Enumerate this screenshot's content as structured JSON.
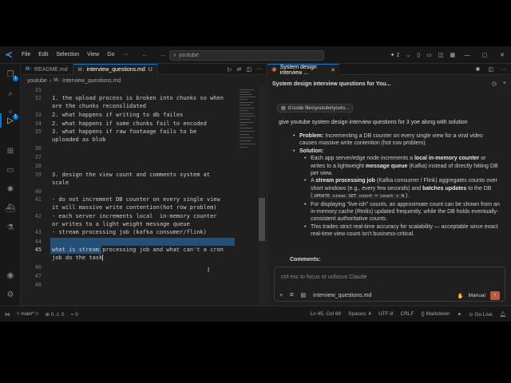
{
  "titlebar": {
    "menu": [
      "File",
      "Edit",
      "Selection",
      "View",
      "Go"
    ],
    "search": "youtube",
    "copilot_count": "2"
  },
  "activity": {
    "explorer_badge": "1",
    "scm_badge": "1"
  },
  "editor": {
    "tabs": [
      {
        "label": "README.md",
        "modified": ""
      },
      {
        "label": "interview_questions.md",
        "modified": "U"
      }
    ],
    "breadcrumb": [
      "youtube",
      "interview_questions.md"
    ],
    "lines": [
      {
        "n": "31",
        "text": ""
      },
      {
        "n": "32",
        "text": "1. the upload process is broken into chunks so when"
      },
      {
        "n": "",
        "text": "are the chunks reconslidated"
      },
      {
        "n": "33",
        "text": "2. what happens if writing to db failes"
      },
      {
        "n": "34",
        "text": "2. what happens if some chunks fail to encoded"
      },
      {
        "n": "35",
        "text": "3. what happens if raw footaage fails to be"
      },
      {
        "n": "",
        "text": "uploaded as blob"
      },
      {
        "n": "36",
        "text": ""
      },
      {
        "n": "37",
        "text": ""
      },
      {
        "n": "38",
        "text": ""
      },
      {
        "n": "39",
        "text": "3. design the view count and comments system at"
      },
      {
        "n": "",
        "text": "scale"
      },
      {
        "n": "40",
        "text": ""
      },
      {
        "n": "41",
        "text": "- do not increment DB counter on every single view"
      },
      {
        "n": "",
        "text": "it will massive write contention(hot row problem)"
      },
      {
        "n": "42",
        "text": "- each server increments local  in-memory counter"
      },
      {
        "n": "",
        "text": "or writes to a light weight message queue"
      },
      {
        "n": "43",
        "text": "- stream processing job (kafka consumer/flink)"
      },
      {
        "n": "44",
        "text": ""
      },
      {
        "n": "45",
        "text": "what is stream processing job and what can't a cron"
      },
      {
        "n": "",
        "text": "job do the task"
      },
      {
        "n": "46",
        "text": ""
      },
      {
        "n": "47",
        "text": ""
      },
      {
        "n": "48",
        "text": ""
      }
    ]
  },
  "claude": {
    "tab_title": "System design interview ...",
    "conversation_title": "System design interview questions for You...",
    "file_chip": "d:\\code files\\youtube\\youto...",
    "user_message": "give youtube system design interview questions for 3 yoe  along with solution",
    "problem_label": "Problem:",
    "problem_text": "Incrementing a DB counter on every single view for a viral video causes massive write contention (hot row problem).",
    "solution_label": "Solution:",
    "s1_pre": "Each app server/edge node increments a ",
    "s1_b1": "local in-memory counter",
    "s1_mid": " or writes to a lightweight ",
    "s1_b2": "message queue",
    "s1_post": " (Kafka) instead of directly hitting DB per view.",
    "s2_pre": "A ",
    "s2_b1": "stream processing job",
    "s2_mid": " (Kafka consumer / Flink) aggregates counts over short windows (e.g., every few seconds) and ",
    "s2_b2": "batches updates",
    "s2_post1": " to the DB (",
    "s2_code": "UPDATE views SET count = count + N",
    "s2_post2": ").",
    "s3": "For displaying \"live-ish\" counts, an approximate count can be shown from an in-memory cache (Redis) updated frequently, while the DB holds eventually-consistent authoritative counts.",
    "s4": "This trades strict real-time accuracy for scalability — acceptable since exact real-time view count isn't business-critical.",
    "comments_label": "Comments:",
    "input_placeholder": "ctrl esc to focus or unfocus Claude",
    "input_file": "interview_questions.md",
    "mode": "Manual"
  },
  "status": {
    "branch": "main*",
    "errors": "0",
    "warnings": "0",
    "position": "Ln 45, Col 68",
    "spaces": "Spaces: 4",
    "encoding": "UTF-8",
    "eol": "CRLF",
    "language": "Markdown",
    "golive": "Go Live"
  }
}
